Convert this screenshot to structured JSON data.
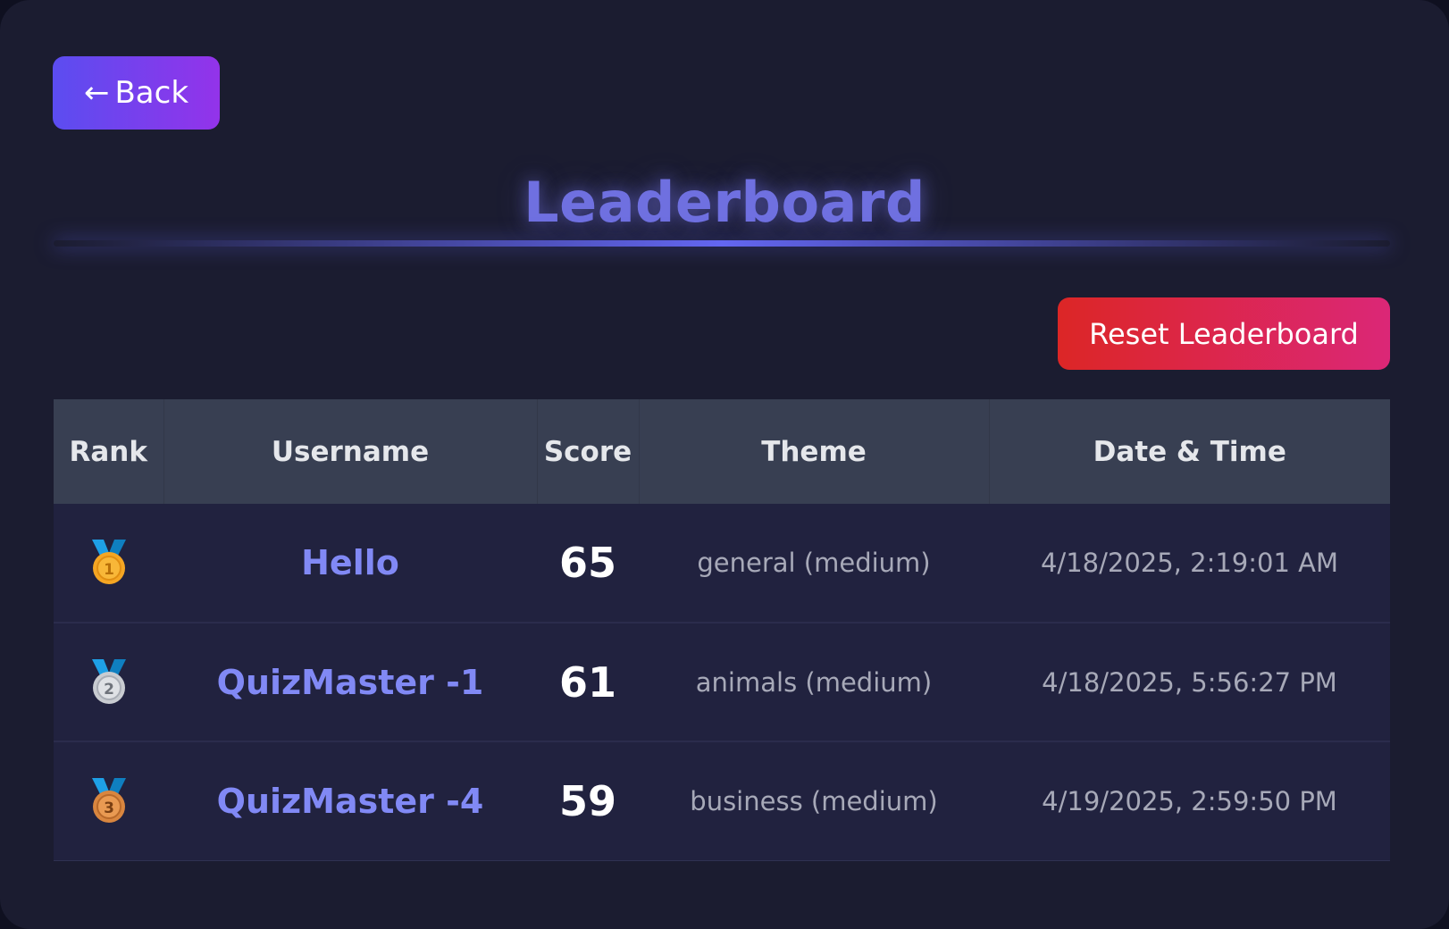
{
  "back_button": {
    "arrow": "←",
    "label": "Back"
  },
  "title": "Leaderboard",
  "reset_button": {
    "label": "Reset Leaderboard"
  },
  "table": {
    "headers": {
      "rank": "Rank",
      "username": "Username",
      "score": "Score",
      "theme": "Theme",
      "datetime": "Date & Time"
    },
    "rows": [
      {
        "rank": "1",
        "medal": "gold-medal-icon",
        "username": "Hello",
        "score": "65",
        "theme": "general (medium)",
        "datetime": "4/18/2025, 2:19:01 AM"
      },
      {
        "rank": "2",
        "medal": "silver-medal-icon",
        "username": "QuizMaster -1",
        "score": "61",
        "theme": "animals (medium)",
        "datetime": "4/18/2025, 5:56:27 PM"
      },
      {
        "rank": "3",
        "medal": "bronze-medal-icon",
        "username": "QuizMaster -4",
        "score": "59",
        "theme": "business (medium)",
        "datetime": "4/19/2025, 2:59:50 PM"
      }
    ]
  },
  "colors": {
    "background": "#1b1c30",
    "accent": "#6f70e0",
    "username": "#8189f5",
    "reset_gradient": [
      "#dc2626",
      "#db2777"
    ],
    "back_gradient": [
      "#5b4df0",
      "#9333ea"
    ],
    "gold": "#f5a623",
    "silver": "#c9ccd1",
    "bronze": "#d9863f",
    "ribbon": "#1ea0e6"
  }
}
